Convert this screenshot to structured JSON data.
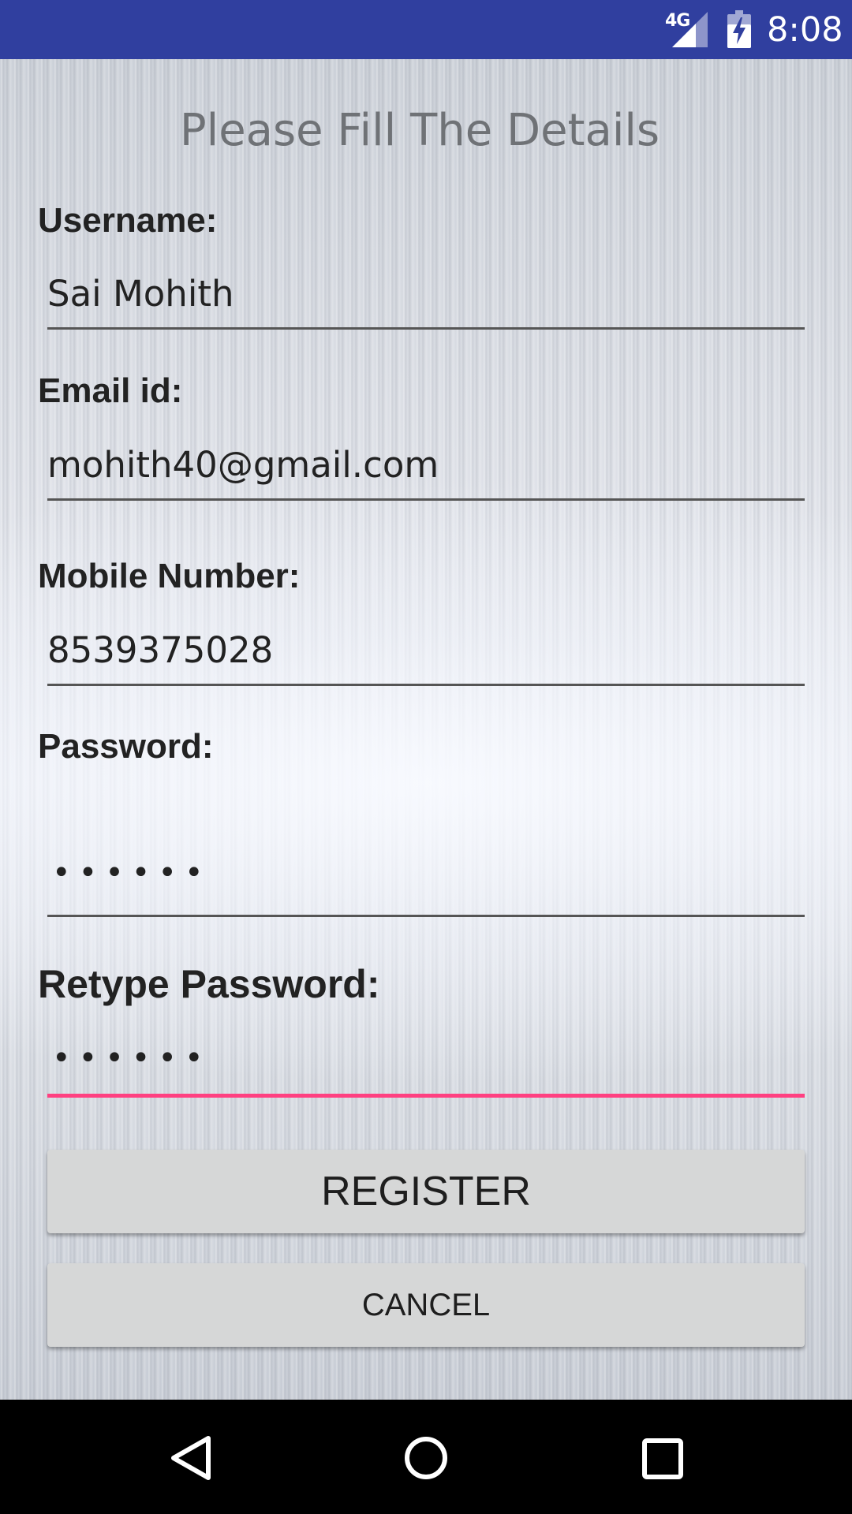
{
  "status_bar": {
    "network_label": "4G",
    "time": "8:08",
    "icons": [
      "signal-icon",
      "battery-charging-icon"
    ]
  },
  "page": {
    "title": "Please Fill The Details"
  },
  "form": {
    "username": {
      "label": "Username:",
      "value": "Sai Mohith"
    },
    "email": {
      "label": "Email id:",
      "value": "mohith40@gmail.com"
    },
    "mobile": {
      "label": "Mobile Number:",
      "value": "8539375028"
    },
    "password": {
      "label": "Password:",
      "value": "••••••"
    },
    "retype_password": {
      "label": "Retype Password:",
      "value": "••••••"
    }
  },
  "buttons": {
    "register": "REGISTER",
    "cancel": "CANCEL"
  },
  "colors": {
    "status_bar": "#303F9F",
    "accent": "#FF4081",
    "button_bg": "#d6d7d7"
  },
  "nav_bar": {
    "icons": [
      "back-icon",
      "home-icon",
      "recents-icon"
    ]
  }
}
